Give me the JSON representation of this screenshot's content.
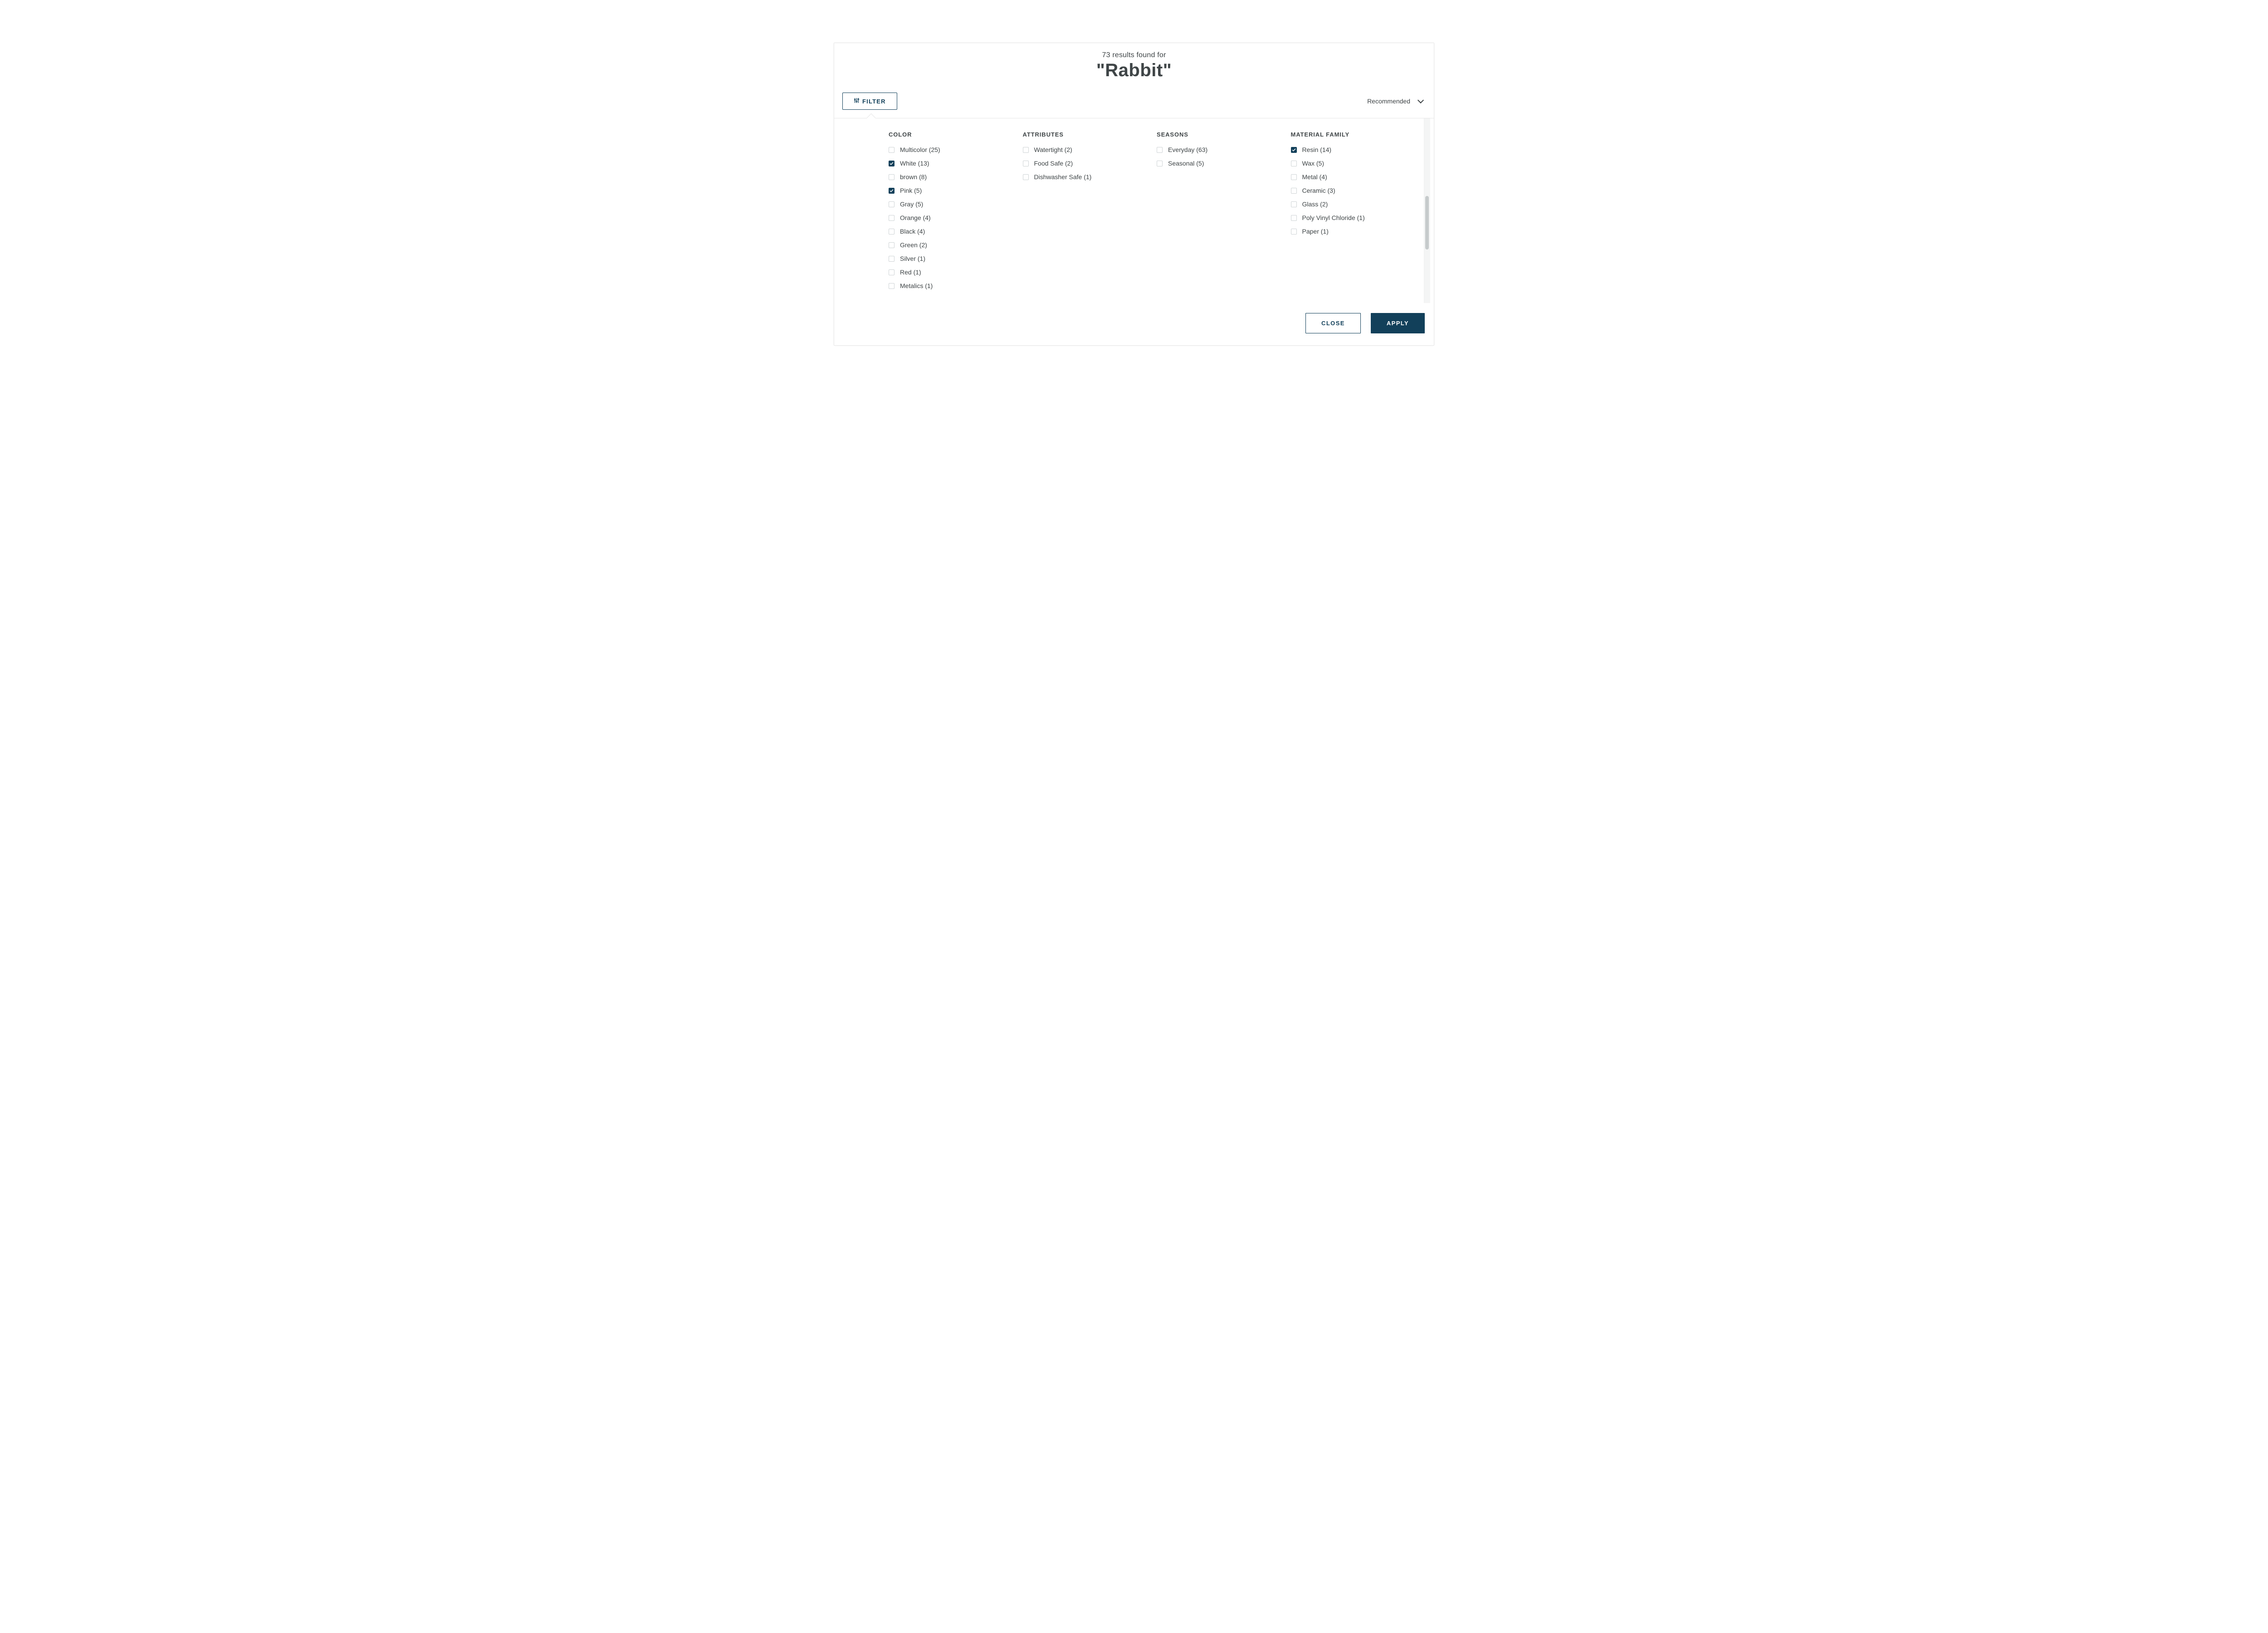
{
  "header": {
    "count_text": "73 results found for",
    "term_display": "\"Rabbit\""
  },
  "toolbar": {
    "filter_label": "FILTER",
    "sort_label": "Recommended"
  },
  "filters": {
    "columns": [
      {
        "title": "COLOR",
        "options": [
          {
            "label": "Multicolor (25)",
            "checked": false
          },
          {
            "label": "White (13)",
            "checked": true
          },
          {
            "label": "brown (8)",
            "checked": false
          },
          {
            "label": "Pink (5)",
            "checked": true
          },
          {
            "label": "Gray (5)",
            "checked": false
          },
          {
            "label": "Orange (4)",
            "checked": false
          },
          {
            "label": "Black (4)",
            "checked": false
          },
          {
            "label": "Green (2)",
            "checked": false
          },
          {
            "label": "Silver (1)",
            "checked": false
          },
          {
            "label": "Red (1)",
            "checked": false
          },
          {
            "label": "Metalics (1)",
            "checked": false
          }
        ]
      },
      {
        "title": "ATTRIBUTES",
        "options": [
          {
            "label": "Watertight (2)",
            "checked": false
          },
          {
            "label": "Food Safe (2)",
            "checked": false
          },
          {
            "label": "Dishwasher Safe (1)",
            "checked": false
          }
        ]
      },
      {
        "title": "SEASONS",
        "options": [
          {
            "label": "Everyday (63)",
            "checked": false
          },
          {
            "label": "Seasonal (5)",
            "checked": false
          }
        ]
      },
      {
        "title": "MATERIAL FAMILY",
        "options": [
          {
            "label": "Resin (14)",
            "checked": true
          },
          {
            "label": "Wax (5)",
            "checked": false
          },
          {
            "label": "Metal (4)",
            "checked": false
          },
          {
            "label": "Ceramic (3)",
            "checked": false
          },
          {
            "label": "Glass (2)",
            "checked": false
          },
          {
            "label": "Poly Vinyl Chloride (1)",
            "checked": false
          },
          {
            "label": "Paper (1)",
            "checked": false
          }
        ]
      }
    ]
  },
  "actions": {
    "close_label": "CLOSE",
    "apply_label": "APPLY"
  },
  "scrollbar": {
    "thumb_top_pct": 42,
    "thumb_height_pct": 29
  }
}
